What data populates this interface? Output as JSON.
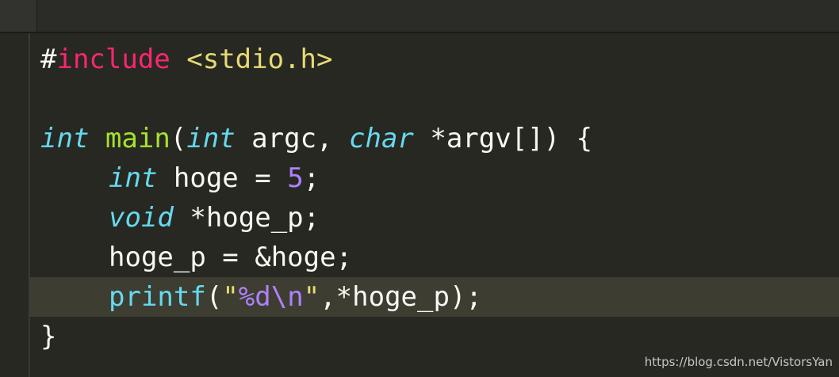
{
  "code": {
    "line1": {
      "hash": "#",
      "directive": "include",
      "space": " ",
      "header": "<stdio.h>"
    },
    "line3": {
      "type_int": "int",
      "sp1": " ",
      "fn": "main",
      "open": "(",
      "type_int2": "int",
      "argc": " argc, ",
      "type_char": "char",
      "argv": " *argv[]) {"
    },
    "line4": {
      "type": "int",
      "rest1": " hoge = ",
      "num": "5",
      "rest2": ";"
    },
    "line5": {
      "type": "void",
      "rest": " *hoge_p;"
    },
    "line6": {
      "text": "hoge_p = &hoge;"
    },
    "line7": {
      "call": "printf",
      "open": "(",
      "str_open": "\"",
      "fmt": "%d",
      "esc": "\\n",
      "str_close": "\"",
      "rest": ",*hoge_p);"
    },
    "line8": {
      "text": "}"
    }
  },
  "watermark": "https://blog.csdn.net/VistorsYan"
}
